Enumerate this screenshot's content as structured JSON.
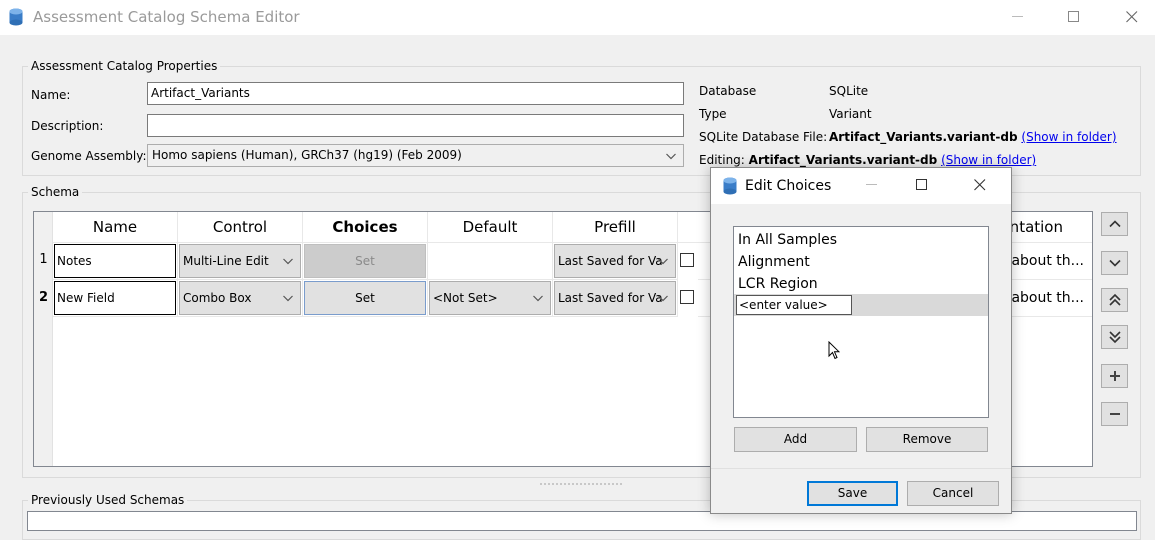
{
  "window": {
    "title": "Assessment Catalog Schema Editor",
    "icon": "database-icon"
  },
  "properties": {
    "group_title": "Assessment Catalog Properties",
    "name_label": "Name:",
    "name_value": "Artifact_Variants",
    "description_label": "Description:",
    "description_value": "",
    "genome_label": "Genome Assembly:",
    "genome_value": "Homo sapiens (Human), GRCh37 (hg19) (Feb 2009)",
    "database_label": "Database",
    "database_value": "SQLite",
    "type_label": "Type",
    "type_value": "Variant",
    "sqlite_file_label": "SQLite Database File:",
    "sqlite_file_value": "Artifact_Variants.variant-db",
    "show_in_folder": "(Show in folder)",
    "editing_label": "Editing:",
    "editing_value": "Artifact_Variants.variant-db"
  },
  "schema": {
    "group_title": "Schema",
    "columns": [
      "Name",
      "Control",
      "Choices",
      "Default",
      "Prefill",
      "entation"
    ],
    "rows": [
      {
        "num": "1",
        "name": "Notes",
        "control": "Multi-Line Edit",
        "choices": "Set",
        "default": "",
        "prefill": "Last Saved for Va",
        "doc": "about th..."
      },
      {
        "num": "2",
        "name": "New Field",
        "control": "Combo Box",
        "choices": "Set",
        "default": "<Not Set>",
        "prefill": "Last Saved for Va",
        "doc": "about th..."
      }
    ],
    "side_buttons": [
      "move-up",
      "move-down",
      "move-top",
      "move-bottom",
      "add",
      "remove"
    ]
  },
  "previous": {
    "group_title": "Previously Used Schemas"
  },
  "dialog": {
    "title": "Edit Choices",
    "items": [
      "In All Samples",
      "Alignment",
      "LCR Region"
    ],
    "new_value_placeholder": "<enter value>",
    "add_label": "Add",
    "remove_label": "Remove",
    "save_label": "Save",
    "cancel_label": "Cancel"
  },
  "colors": {
    "link": "#0000ee",
    "focus_border": "#0078d7",
    "selected_row": "#d9d9d9"
  }
}
